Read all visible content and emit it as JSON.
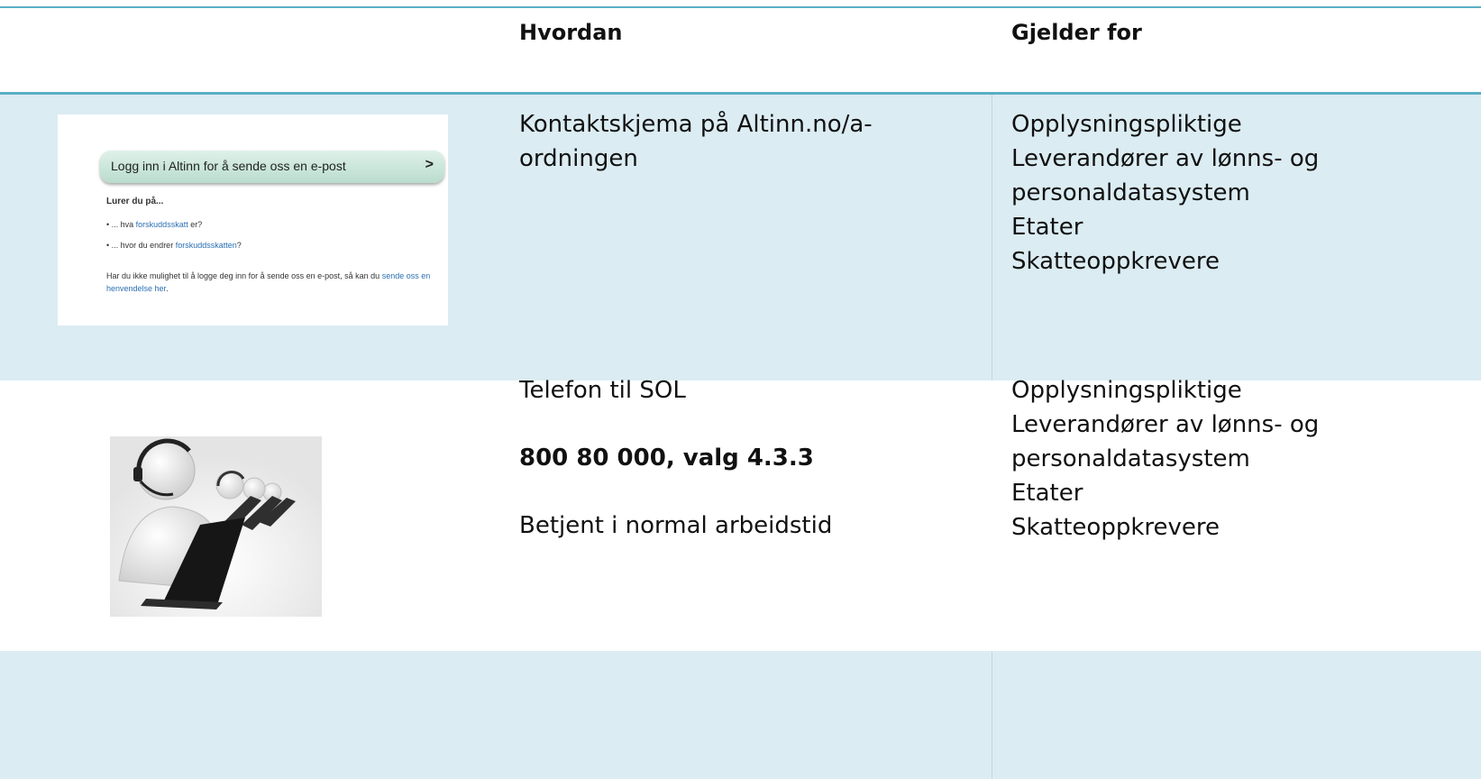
{
  "header": {
    "col_how": "Hvordan",
    "col_applies": "Gjelder for"
  },
  "rows": [
    {
      "thumbnail": {
        "login_label": "Logg inn i Altinn for å sende oss en e-post",
        "chevron": ">",
        "heading": "Lurer du på...",
        "item1_prefix": "• ... hva ",
        "item1_link": "forskuddsskatt",
        "item1_suffix": " er?",
        "item2_prefix": "• ... hvor du endrer ",
        "item2_link": "forskuddsskatten",
        "item2_suffix": "?",
        "para_text": "Har du ikke mulighet til å logge deg inn for å sende oss en e-post, så kan du ",
        "para_link": "sende oss en henvendelse her",
        "para_end": "."
      },
      "how": "Kontaktskjema på Altinn.no/a-\nordningen",
      "applies": "Opplysningspliktige\nLeverandører av lønns- og\npersonaldatasystem\nEtater\nSkatteoppkrevere"
    },
    {
      "how_line1": "Telefon til SOL",
      "how_phone": "800 80 000, valg 4.3.3",
      "how_line3": "Betjent i normal arbeidstid",
      "applies": "Opplysningspliktige\nLeverandører av lønns- og\npersonaldatasystem\nEtater\nSkatteoppkrevere",
      "image_icon": "call-center-illustration"
    }
  ],
  "colors": {
    "rule": "#5aafc4",
    "shade": "#dbecf2"
  }
}
